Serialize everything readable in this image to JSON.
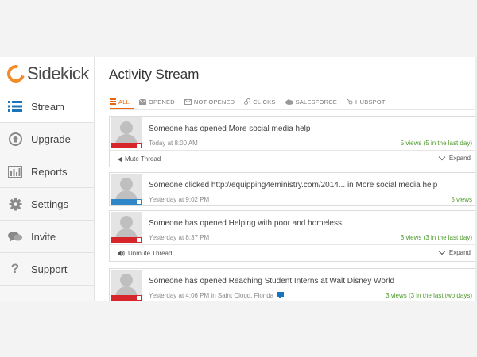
{
  "sidebar": {
    "logo_text": "Sidekick",
    "items": [
      {
        "label": "Stream",
        "icon": "list-icon"
      },
      {
        "label": "Upgrade",
        "icon": "upgrade-icon"
      },
      {
        "label": "Reports",
        "icon": "bar-chart-icon"
      },
      {
        "label": "Settings",
        "icon": "gear-icon"
      },
      {
        "label": "Invite",
        "icon": "chat-icon"
      },
      {
        "label": "Support",
        "icon": "question-icon"
      }
    ]
  },
  "main": {
    "title": "Activity Stream",
    "tabs": [
      {
        "label": "ALL",
        "icon": "stack-icon"
      },
      {
        "label": "OPENED",
        "icon": "envelope-icon"
      },
      {
        "label": "NOT OPENED",
        "icon": "envelope-outline-icon"
      },
      {
        "label": "CLICKS",
        "icon": "link-icon"
      },
      {
        "label": "SALESFORCE",
        "icon": "cloud-icon"
      },
      {
        "label": "HUBSPOT",
        "icon": "sprocket-icon"
      }
    ]
  },
  "stream": [
    {
      "who": "Someone",
      "action": " has opened More social media help",
      "time": "Today at 8:00 AM",
      "views": "5 views (5 in the last day)",
      "bar_color": "#d6252b",
      "footer": {
        "mute": "Mute Thread",
        "expand": "Expand"
      }
    },
    {
      "who": "Someone",
      "action": " clicked http://equipping4eministry.com/2014... in More social media help",
      "time": "Yesterday at 9:02 PM",
      "views": "5 views",
      "bar_color": "#2f86c8"
    },
    {
      "who": "Someone",
      "action": " has opened Helping with poor and homeless",
      "time": "Yesterday at 8:37 PM",
      "views": "3 views (3 in the last day)",
      "bar_color": "#d6252b",
      "footer": {
        "mute": "Unmute Thread",
        "expand": "Expand"
      }
    },
    {
      "who": "Someone",
      "action": " has opened Reaching Student Interns at Walt Disney World",
      "time": "Yesterday at 4:06 PM in Saint Cloud, Florida",
      "views": "3 views (3 in the last two days)",
      "bar_color": "#d6252b"
    }
  ]
}
